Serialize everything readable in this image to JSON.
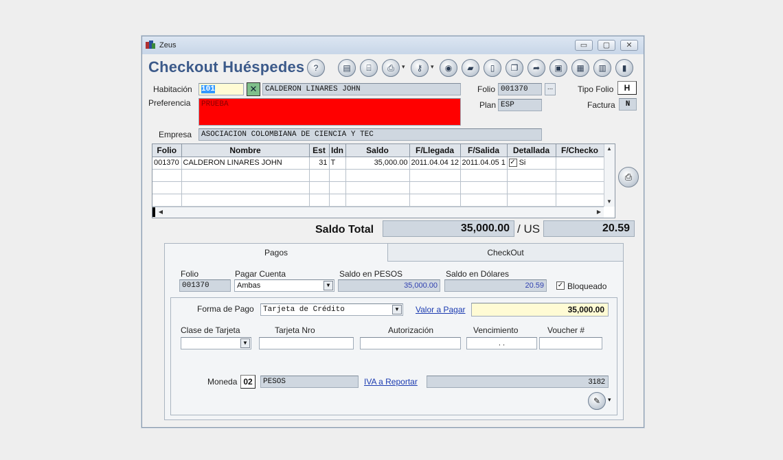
{
  "window": {
    "title": "Zeus",
    "minimize": "▭",
    "maximize": "▢",
    "close": "✕"
  },
  "app_title": "Checkout Huéspedes",
  "toolbar": {
    "help": "?",
    "icons": [
      "list-icon",
      "folder-open-icon",
      "print-icon",
      "key-icon",
      "record-icon",
      "bookmark-icon",
      "card-icon",
      "copy-icon",
      "forward-icon",
      "window-icon",
      "save-icon",
      "document-icon",
      "exit-icon"
    ]
  },
  "header": {
    "habitacion_label": "Habitación",
    "habitacion_value": "101",
    "guest_name": "CALDERON LINARES JOHN",
    "preferencia_label": "Preferencia",
    "preferencia_value": "PRUEBA",
    "empresa_label": "Empresa",
    "empresa_value": "ASOCIACION COLOMBIANA DE CIENCIA Y TEC",
    "folio_label": "Folio",
    "folio_value": "001370",
    "folio_lookup": "...",
    "plan_label": "Plan",
    "plan_value": "ESP",
    "tipo_folio_label": "Tipo Folio",
    "tipo_folio_value": "H",
    "factura_label": "Factura",
    "factura_value": "N",
    "preferencia_color": "#ff0000"
  },
  "grid": {
    "columns": [
      "Folio",
      "Nombre",
      "Est",
      "Idn",
      "Saldo",
      "F/Llegada",
      "F/Salida",
      "Detallada",
      "F/Checko"
    ],
    "rows": [
      [
        "001370",
        "CALDERON LINARES JOHN",
        "31",
        "T",
        "35,000.00",
        "2011.04.04 12",
        "2011.04.05 1",
        "Si",
        ""
      ]
    ]
  },
  "totals": {
    "label": "Saldo Total",
    "pesos": "35,000.00",
    "separator": "/ US",
    "dollars": "20.59"
  },
  "tabs": [
    "Pagos",
    "CheckOut"
  ],
  "pagos": {
    "folio_label": "Folio",
    "folio_value": "001370",
    "pagar_cuenta_label": "Pagar Cuenta",
    "pagar_cuenta_value": "Ambas",
    "saldo_pesos_label": "Saldo en PESOS",
    "saldo_pesos_value": "35,000.00",
    "saldo_dolares_label": "Saldo en Dólares",
    "saldo_dolares_value": "20.59",
    "bloqueado_label": "Bloqueado",
    "bloqueado_checked": true,
    "forma_pago_label": "Forma de Pago",
    "forma_pago_value": "Tarjeta de Crédito",
    "valor_pagar_label": "Valor a Pagar",
    "valor_pagar_value": "35,000.00",
    "clase_tarjeta_label": "Clase de Tarjeta",
    "clase_tarjeta_value": "",
    "tarjeta_nro_label": "Tarjeta Nro",
    "autorizacion_label": "Autorización",
    "vencimiento_label": "Vencimiento",
    "vencimiento_value": " . .",
    "voucher_label": "Voucher #",
    "moneda_label": "Moneda",
    "moneda_code": "02",
    "moneda_name": "PESOS",
    "iva_label": "IVA a Reportar",
    "iva_value": "3182"
  }
}
